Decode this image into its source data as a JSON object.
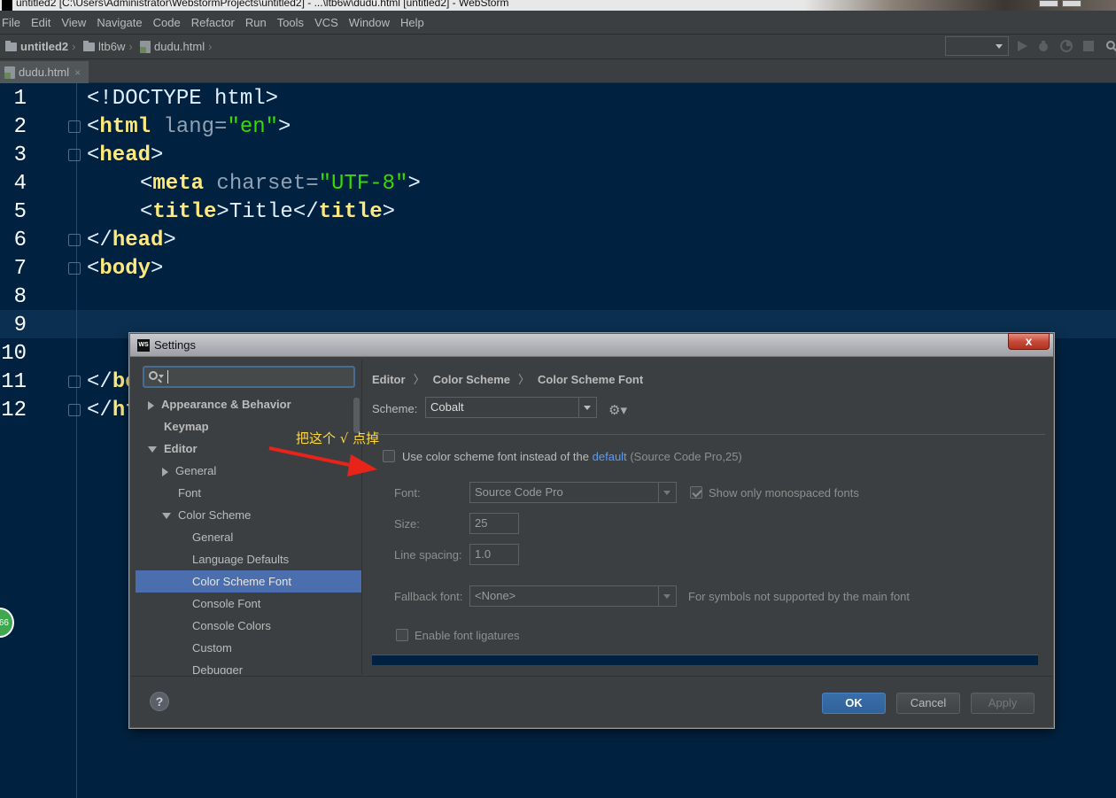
{
  "window": {
    "title": "untitled2 [C:\\Users\\Administrator\\WebstormProjects\\untitled2] - ...\\ltb6w\\dudu.html [untitled2] - WebStorm"
  },
  "menu": [
    {
      "label": "File"
    },
    {
      "label": "Edit"
    },
    {
      "label": "View"
    },
    {
      "label": "Navigate"
    },
    {
      "label": "Code"
    },
    {
      "label": "Refactor"
    },
    {
      "label": "Run"
    },
    {
      "label": "Tools"
    },
    {
      "label": "VCS"
    },
    {
      "label": "Window"
    },
    {
      "label": "Help"
    }
  ],
  "breadcrumb": {
    "project": "untitled2",
    "folder": "ltb6w",
    "file": "dudu.html"
  },
  "tab": {
    "label": "dudu.html",
    "close": "×"
  },
  "editor": {
    "line_numbers": [
      "1",
      "2",
      "3",
      "4",
      "5",
      "6",
      "7",
      "8",
      "9",
      "10",
      "11",
      "12"
    ],
    "l1": "<!DOCTYPE html>",
    "l2_open": "<",
    "l2_tag": "html",
    "l2_attr": " lang=",
    "l2_val": "\"en\"",
    "l2_close": ">",
    "l3_open": "<",
    "l3_tag": "head",
    "l3_close": ">",
    "l4_open": "<",
    "l4_tag": "meta",
    "l4_attr": " charset=",
    "l4_val": "\"UTF-8\"",
    "l4_close": ">",
    "l5_open": "<",
    "l5_tag": "title",
    "l5_mid": ">Title</",
    "l5_tag2": "title",
    "l5_close": ">",
    "l6_open": "</",
    "l6_tag": "head",
    "l6_close": ">",
    "l7_open": "<",
    "l7_tag": "body",
    "l7_close": ">",
    "l11_open": "</",
    "l11_tag": "bo",
    "l12_open": "</",
    "l12_tag": "ht"
  },
  "side_badge": "66",
  "dialog": {
    "title": "Settings",
    "close": "x",
    "search": {
      "placeholder": ""
    },
    "tree": [
      {
        "label": "Appearance & Behavior"
      },
      {
        "label": "Keymap"
      },
      {
        "label": "Editor"
      },
      {
        "label": "General"
      },
      {
        "label": "Font"
      },
      {
        "label": "Color Scheme"
      },
      {
        "label": "General"
      },
      {
        "label": "Language Defaults"
      },
      {
        "label": "Color Scheme Font"
      },
      {
        "label": "Console Font"
      },
      {
        "label": "Console Colors"
      },
      {
        "label": "Custom"
      },
      {
        "label": "Debugger"
      }
    ],
    "crumbs": [
      "Editor",
      "Color Scheme",
      "Color Scheme Font"
    ],
    "crumb_sep": "〉",
    "scheme_label": "Scheme:",
    "scheme_value": "Cobalt",
    "use_scheme_font": {
      "prefix": "Use color scheme font instead of the",
      "link": "default",
      "suffix": "(Source Code Pro,25)",
      "checked": false
    },
    "font_label": "Font:",
    "font_value": "Source Code Pro",
    "mono_label": "Show only monospaced fonts",
    "mono_checked": true,
    "size_label": "Size:",
    "size_value": "25",
    "spacing_label": "Line spacing:",
    "spacing_value": "1.0",
    "fallback_label": "Fallback font:",
    "fallback_value": "<None>",
    "fallback_hint": "For symbols not supported by the main font",
    "ligatures_label": "Enable font ligatures",
    "buttons": {
      "help": "?",
      "ok": "OK",
      "cancel": "Cancel",
      "apply": "Apply"
    }
  },
  "annotation": {
    "text": "把这个 √ 点掉",
    "color": "#ffd83a",
    "arrow_color": "#e8231a"
  },
  "colors": {
    "editor_bg": "#002240",
    "tag": "#ffe97e",
    "string": "#3ad900",
    "selection": "#4b6eaf"
  }
}
